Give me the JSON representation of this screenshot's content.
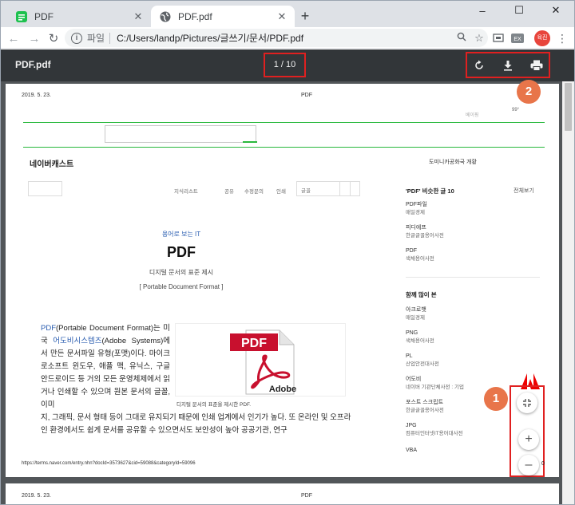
{
  "browser": {
    "tabs": [
      {
        "label": "PDF"
      },
      {
        "label": "PDF.pdf"
      }
    ],
    "new_tab": "+",
    "window_controls": {
      "minimize": "–",
      "maximize": "☐",
      "close": "✕"
    },
    "address": {
      "scheme_label": "파일",
      "url": "C:/Users/landp/Pictures/글쓰기/문서/PDF.pdf"
    },
    "profile_initials": "육진"
  },
  "viewer": {
    "title": "PDF.pdf",
    "page_indicator": "1 / 10",
    "zoom_out_tail": "0"
  },
  "annotations": {
    "badge1": "1",
    "badge2": "2"
  },
  "page1": {
    "header_date": "2019. 5. 23.",
    "header_title": "PDF",
    "top_tiny_left": "베이핑",
    "top_tiny_right": "99°",
    "brand": "네이버캐스트",
    "brand_right": "도미니카공화국 개황",
    "top_links": [
      "지식리스트",
      "공유",
      "수정문의",
      "인쇄"
    ],
    "search_placeholder": "글꼴",
    "kicker": "용어로 보는 IT",
    "title": "PDF",
    "subtitle": "디지털 문서의 표준 제시",
    "subtitle2": "[ Portable Document Format ]",
    "body_link1": "PDF",
    "body_p1a": "(Portable Document Format)는 미국 ",
    "body_link2": "어도비시스템즈",
    "body_p1b": "(Adobe Systems)에서 만든 문서파일 유형(포맷)이다. 마이크로소프트 윈도우, 애플 맥, 유닉스, 구글 안드로이드 등 거의 모든 운영체제에서 읽거나 인쇄할 수 있으며 원본 문서의 글꼴, 이미",
    "body_p2": "지, 그래픽, 문서 형태 등이 그대로 유지되기 때문에 인쇄 업계에서 인기가 높다. 또 온라인 및 오프라인 환경에서도 쉽게 문서를 공유할 수 있으면서도 보안성이 높아 공공기관, 연구",
    "image_pdf": "PDF",
    "image_adobe": "Adobe",
    "image_caption": "디지털 문서의 표준을 제시한 PDF.",
    "footer_url": "https://terms.naver.com/entry.nhn?docId=3573627&cid=59088&categoryId=59096",
    "right_head": "'PDF' 비슷한 글 10",
    "right_all": "전체보기",
    "related": [
      {
        "title": "PDF파일",
        "source": "매일경제"
      },
      {
        "title": "피디에프",
        "source": "한글글꼴용어사전"
      },
      {
        "title": "PDF",
        "source": "색채용어사전"
      }
    ],
    "popular_head": "함께 많이 본",
    "popular": [
      {
        "title": "아크로뱃",
        "source": "매일경제"
      },
      {
        "title": "PNG",
        "source": "색채용어사전"
      },
      {
        "title": "PL",
        "source": "산업안전대사전"
      },
      {
        "title": "어도비",
        "source": "네이버 기관단체사전 : 기업"
      },
      {
        "title": "포스트 스크립트",
        "source": "한글글꼴용어사전"
      },
      {
        "title": "JPG",
        "source": "컴퓨터인터넷IT용어대사전"
      },
      {
        "title": "VBA",
        "source": ""
      }
    ]
  },
  "page2": {
    "header_date": "2019. 5. 23.",
    "header_title": "PDF"
  }
}
